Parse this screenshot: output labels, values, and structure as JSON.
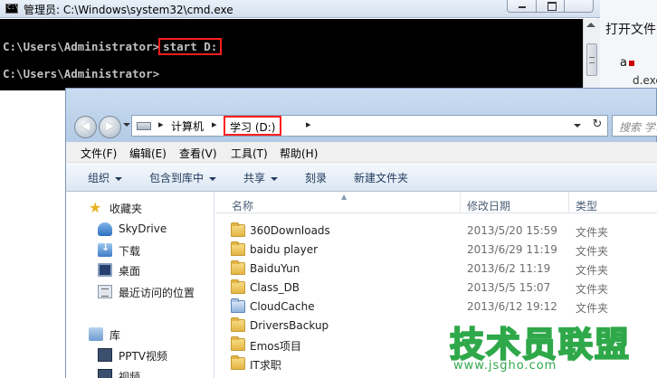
{
  "background_doc": {
    "text_open_file": "打开文件",
    "text_a": "a",
    "text_exe": "d.exe"
  },
  "cmd": {
    "title": "管理员: C:\\Windows\\system32\\cmd.exe",
    "icon_label": "C:\\",
    "prompt1": "C:\\Users\\Administrator>",
    "command": "start D:",
    "prompt2": "C:\\Users\\Administrator>"
  },
  "explorer": {
    "address": {
      "sep": "▸",
      "computer": "计算机",
      "drive": "学习 (D:)",
      "refresh": "↻"
    },
    "nav_buttons": {
      "back": "◀",
      "forward": "▶"
    },
    "search_placeholder": "搜索 学习",
    "menu": [
      "文件(F)",
      "编辑(E)",
      "查看(V)",
      "工具(T)",
      "帮助(H)"
    ],
    "toolbar": [
      "组织",
      "包含到库中",
      "共享",
      "刻录",
      "新建文件夹"
    ],
    "nav_pane": {
      "favorites": "收藏夹",
      "skydrive": "SkyDrive",
      "downloads": "下载",
      "desktop": "桌面",
      "recent": "最近访问的位置",
      "libraries": "库",
      "pptv": "PPTV视频",
      "video": "视频"
    },
    "columns": {
      "name": "名称",
      "modified": "修改日期",
      "type": "类型"
    },
    "files": [
      {
        "name": "360Downloads",
        "date": "2013/5/20 15:59",
        "type": "文件夹"
      },
      {
        "name": "baidu player",
        "date": "2013/6/29 11:19",
        "type": "文件夹"
      },
      {
        "name": "BaiduYun",
        "date": "2013/6/2 11:19",
        "type": "文件夹"
      },
      {
        "name": "Class_DB",
        "date": "2013/5/5 15:07",
        "type": "文件夹"
      },
      {
        "name": "CloudCache",
        "date": "2013/6/12 19:12",
        "type": "文件夹"
      },
      {
        "name": "DriversBackup",
        "date": "",
        "type": ""
      },
      {
        "name": "Emos项目",
        "date": "",
        "type": ""
      },
      {
        "name": "IT求职",
        "date": "",
        "type": ""
      }
    ]
  },
  "watermark": {
    "title": "技术员联盟",
    "url": "www.jsgho.com"
  },
  "colors": {
    "highlight_red": "#ff1e1e",
    "watermark_green": "#2fa84a",
    "folder_yellow": "#e4b545",
    "console_bg": "#000000"
  }
}
